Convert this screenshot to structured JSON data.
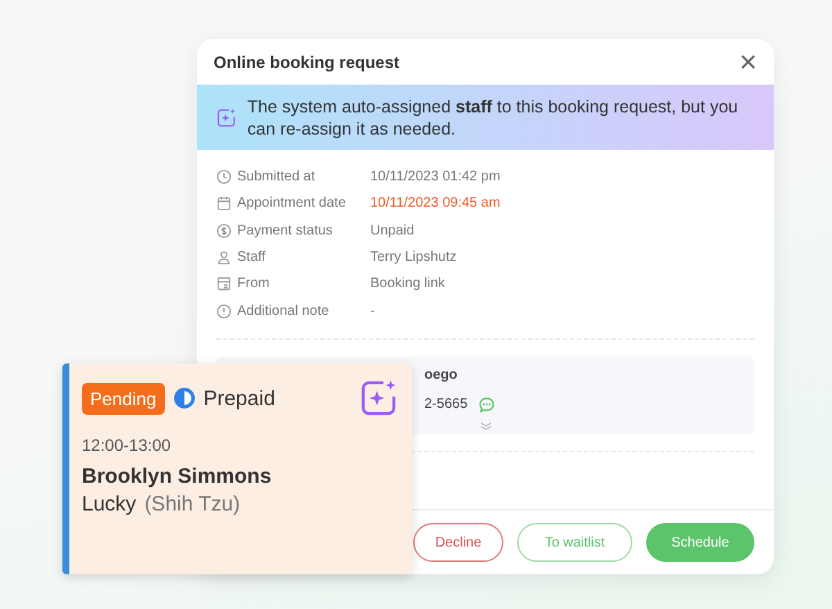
{
  "dialog": {
    "title": "Online booking request",
    "close": "×",
    "banner": {
      "text": "The system auto-assigned **staff** to this booking request, but you can re-assign it as needed."
    },
    "details": [
      {
        "label": "Submitted at",
        "value": "10/11/2023 01:42 pm",
        "highlighted": false
      },
      {
        "label": "Appointment date",
        "value": "10/11/2023 09:45 am",
        "highlighted": true
      },
      {
        "label": "Payment status",
        "value": "Unpaid",
        "highlighted": false
      },
      {
        "label": "Staff",
        "value": "Terry Lipshutz",
        "highlighted": false
      },
      {
        "label": "From",
        "value": "Booking link",
        "highlighted": false
      },
      {
        "label": "Additional note",
        "value": "-",
        "highlighted": false
      }
    ],
    "client": {
      "name": "oego",
      "phone": "2-5665"
    },
    "buttons": [
      {
        "label": "Decline",
        "kind": "danger"
      },
      {
        "label": "To waitlist",
        "kind": "outline"
      },
      {
        "label": "Schedule",
        "kind": "primary"
      }
    ]
  },
  "card": {
    "status": "Pending",
    "payment": "Prepaid",
    "time": "12:00-13:00",
    "client": "Brooklyn Simmons",
    "pet": "Lucky",
    "breed": "(Shih Tzu)"
  }
}
